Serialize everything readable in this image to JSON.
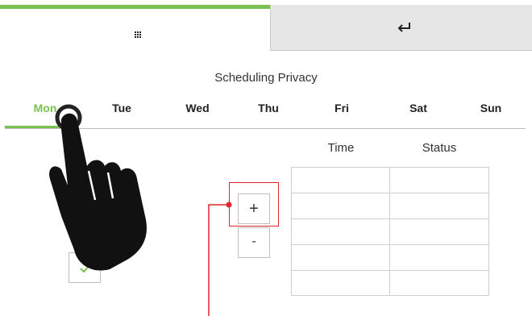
{
  "tabbar": {
    "grid_icon": "grid-icon",
    "back_icon": "return-arrow-icon"
  },
  "page": {
    "title": "Scheduling Privacy"
  },
  "days": [
    "Mon",
    "Tue",
    "Wed",
    "Thu",
    "Fri",
    "Sat",
    "Sun"
  ],
  "active_day": "Mon",
  "table": {
    "columns": [
      "Time",
      "Status"
    ]
  },
  "buttons": {
    "add": "+",
    "remove": "-",
    "confirm_icon": "check-icon"
  },
  "colors": {
    "accent": "#7ac04f",
    "highlight": "#e2242b",
    "tab_inactive": "#e6e6e6"
  }
}
